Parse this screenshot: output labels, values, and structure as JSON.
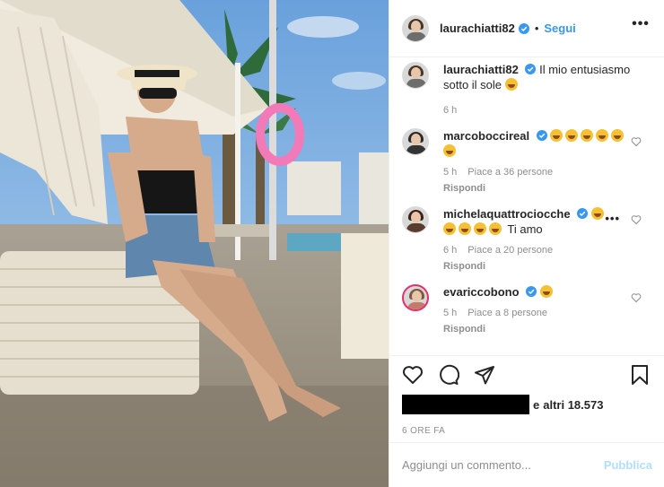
{
  "header": {
    "username": "laurachiatti82",
    "dot": "•",
    "follow_label": "Segui",
    "more": "•••"
  },
  "caption": {
    "username": "laurachiatti82",
    "text": "Il mio entusiasmo sotto il sole",
    "time": "6 h"
  },
  "comments": [
    {
      "username": "marcoboccireal",
      "text": "",
      "time": "5 h",
      "likes": "Piace a 36 persone",
      "reply": "Rispondi"
    },
    {
      "username": "michelaquattrociocche",
      "text": "Ti amo",
      "time": "6 h",
      "likes": "Piace a 20 persone",
      "reply": "Rispondi"
    },
    {
      "username": "evariccobono",
      "text": "",
      "time": "5 h",
      "likes": "Piace a 8 persone",
      "reply": "Rispondi"
    }
  ],
  "likes": {
    "prefix": "e",
    "text": "altri 18.573"
  },
  "timestamp": "6 ORE FA",
  "add_comment": {
    "placeholder": "Aggiungi un commento...",
    "publish_label": "Pubblica"
  },
  "colors": {
    "link": "#3897f0",
    "verified": "#3897f0",
    "publish_disabled": "#b2dffc"
  }
}
